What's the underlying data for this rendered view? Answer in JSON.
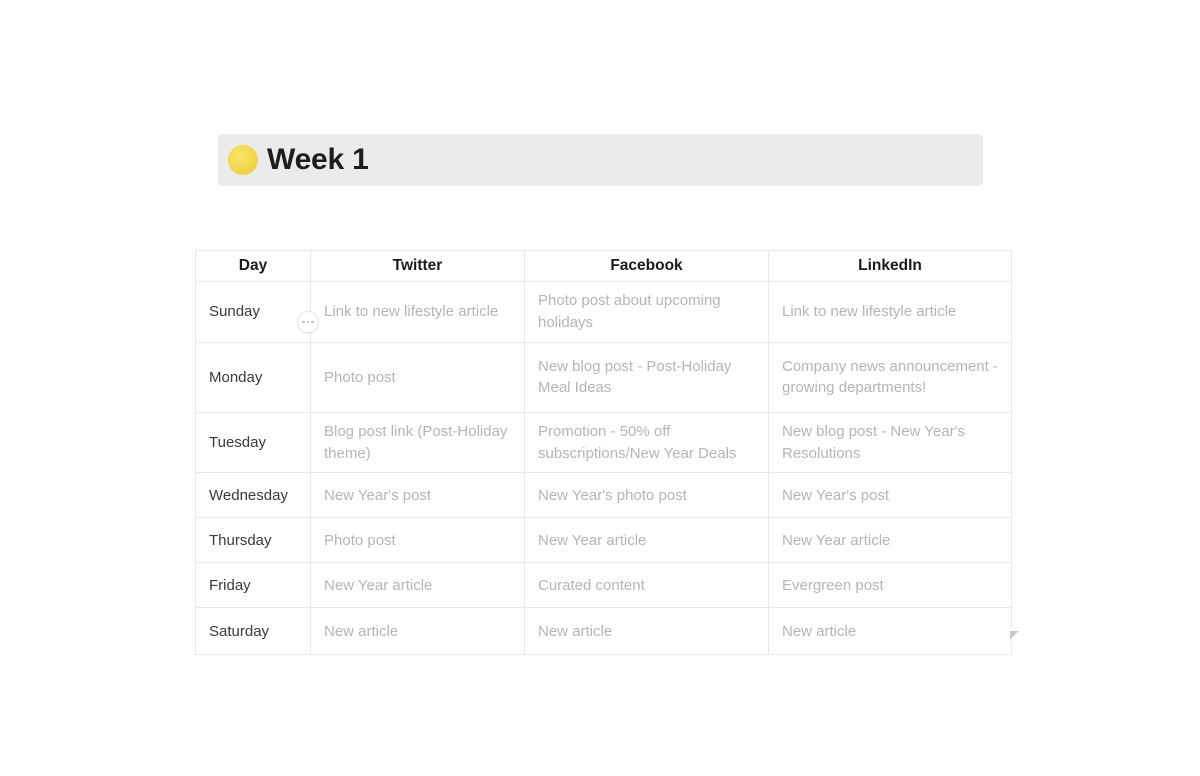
{
  "callout": {
    "emoji": "yellow-circle",
    "title": "Week 1"
  },
  "table": {
    "columns": [
      "Day",
      "Twitter",
      "Facebook",
      "LinkedIn"
    ],
    "rows": [
      {
        "day": "Sunday",
        "twitter": "Link to new lifestyle article",
        "facebook": "Photo post about upcoming holidays",
        "linkedin": "Link to new lifestyle article"
      },
      {
        "day": "Monday",
        "twitter": "Photo post",
        "facebook": "New blog post - Post-Holiday Meal Ideas",
        "linkedin": "Company news announcement - growing departments!"
      },
      {
        "day": "Tuesday",
        "twitter": "Blog post link (Post-Holiday theme)",
        "facebook": "Promotion - 50% off subscriptions/New Year Deals",
        "linkedin": "New blog post - New Year's Resolutions"
      },
      {
        "day": "Wednesday",
        "twitter": "New Year's post",
        "facebook": "New Year's photo post",
        "linkedin": "New Year's post"
      },
      {
        "day": "Thursday",
        "twitter": "Photo post",
        "facebook": "New Year article",
        "linkedin": "New Year article"
      },
      {
        "day": "Friday",
        "twitter": "New Year article",
        "facebook": "Curated content",
        "linkedin": "Evergreen post"
      },
      {
        "day": "Saturday",
        "twitter": "New article",
        "facebook": "New article",
        "linkedin": "New article"
      }
    ]
  },
  "handles": {
    "row_options": "ellipsis-handle",
    "resize": "resize-corner-handle"
  },
  "colors": {
    "callout_background": "#ebebeb",
    "callout_emoji": "#f2d74b",
    "header_text": "#1b1b1b",
    "day_text": "#3a3a3a",
    "cell_text": "#b5b5b5",
    "grid_border": "#e8e8e8",
    "page_background": "#ffffff"
  }
}
